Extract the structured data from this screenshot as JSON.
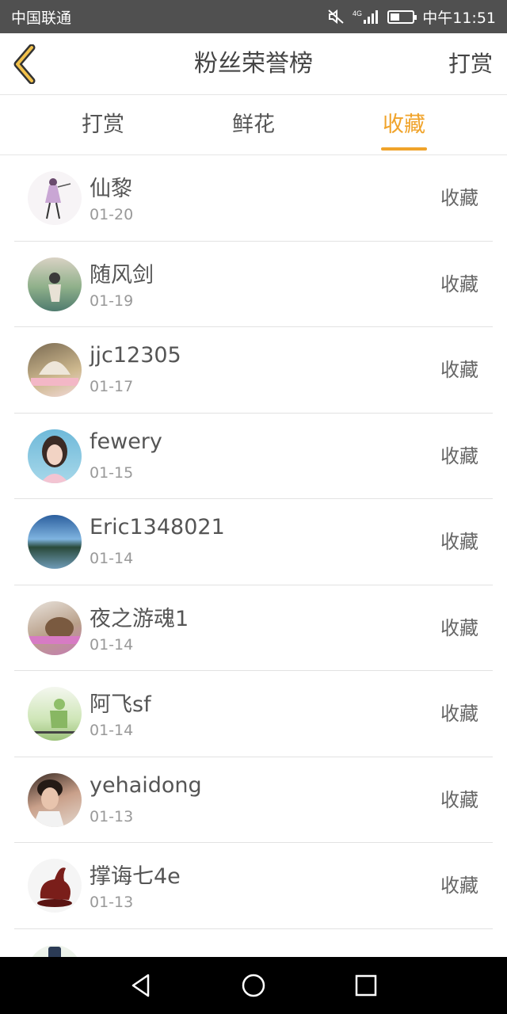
{
  "status_bar": {
    "carrier": "中国联通",
    "network": "4G",
    "time": "中午11:51",
    "battery_level": 0.4
  },
  "header": {
    "title": "粉丝荣誉榜",
    "action": "打赏",
    "back_icon": "chevron-left-icon",
    "accent": "#f0a32a"
  },
  "tabs": [
    {
      "label": "打赏",
      "active": false
    },
    {
      "label": "鲜花",
      "active": false
    },
    {
      "label": "收藏",
      "active": true
    }
  ],
  "fans": [
    {
      "name": "仙黎",
      "date": "01-20",
      "action": "收藏"
    },
    {
      "name": "随风剑",
      "date": "01-19",
      "action": "收藏"
    },
    {
      "name": "jjc12305",
      "date": "01-17",
      "action": "收藏"
    },
    {
      "name": "fewery",
      "date": "01-15",
      "action": "收藏"
    },
    {
      "name": "Eric1348021",
      "date": "01-14",
      "action": "收藏"
    },
    {
      "name": "夜之游魂1",
      "date": "01-14",
      "action": "收藏"
    },
    {
      "name": "阿飞sf",
      "date": "01-14",
      "action": "收藏"
    },
    {
      "name": "yehaidong",
      "date": "01-13",
      "action": "收藏"
    },
    {
      "name": "撑诲七4e",
      "date": "01-13",
      "action": "收藏"
    },
    {
      "name": "",
      "date": "",
      "action": ""
    }
  ],
  "nav": {
    "back": "triangle-back-icon",
    "home": "circle-home-icon",
    "recent": "square-recent-icon"
  }
}
